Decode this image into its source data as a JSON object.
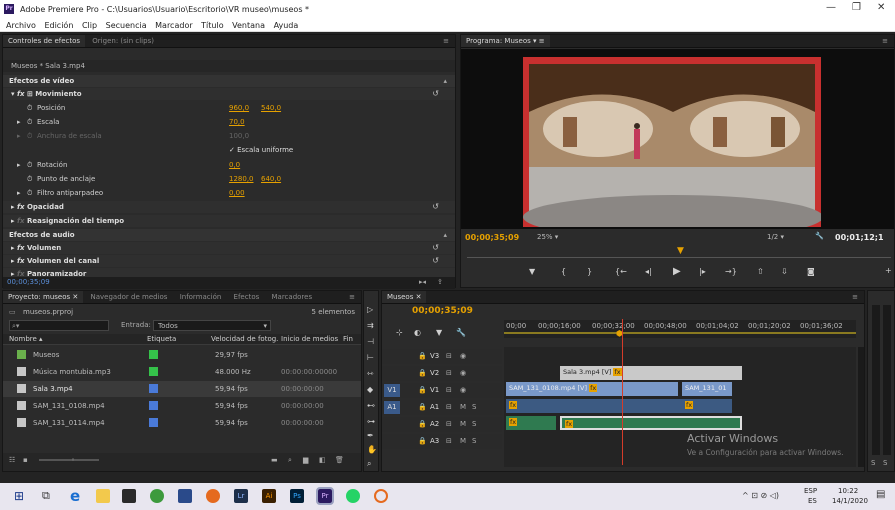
{
  "window": {
    "title": "Adobe Premiere Pro - C:\\Usuarios\\Usuario\\Escritorio\\VR museo\\museos *",
    "app_icon": "Pr"
  },
  "menu": [
    "Archivo",
    "Edición",
    "Clip",
    "Secuencia",
    "Marcador",
    "Título",
    "Ventana",
    "Ayuda"
  ],
  "effects_panel": {
    "tabs": [
      "Controles de efectos",
      "Origen: (sin clips)"
    ],
    "clip": "Museos * Sala 3.mp4",
    "video_header": "Efectos de vídeo",
    "movement": "Movimiento",
    "position_label": "Posición",
    "position_x": "960,0",
    "position_y": "540,0",
    "scale_label": "Escala",
    "scale_value": "70,0",
    "scale_width_label": "Anchura de escala",
    "scale_width_value": "100,0",
    "uniform_scale": "Escala uniforme",
    "rotation_label": "Rotación",
    "rotation_value": "0,0",
    "anchor_label": "Punto de anclaje",
    "anchor_x": "1280,0",
    "anchor_y": "640,0",
    "flicker_label": "Filtro antiparpadeo",
    "flicker_value": "0,00",
    "opacity": "Opacidad",
    "time_remap": "Reasignación del tiempo",
    "audio_header": "Efectos de audio",
    "volume": "Volumen",
    "channel_volume": "Volumen del canal",
    "panner": "Panoramizador",
    "timecode": "00;00;35;09"
  },
  "program_monitor": {
    "tab": "Programa: Museos",
    "timecode": "00;00;35;09",
    "zoom": "25%",
    "resolution": "1/2",
    "duration": "00;01;12;1",
    "frame_border_color": "#c8302f"
  },
  "project_panel": {
    "tabs": [
      "Proyecto: museos",
      "Navegador de medios",
      "Información",
      "Efectos",
      "Marcadores"
    ],
    "file": "museos.prproj",
    "count": "5 elementos",
    "search_placeholder": "",
    "entries_label": "Entrada:",
    "entries_value": "Todos",
    "columns": [
      "Nombre",
      "Etiqueta",
      "Velocidad de fotog.",
      "Inicio de medios",
      "Fin"
    ],
    "items": [
      {
        "name": "Museos",
        "color": "#35c24a",
        "fps": "29,97 fps",
        "start": ""
      },
      {
        "name": "Música montubia.mp3",
        "color": "#35c24a",
        "fps": "48.000 Hz",
        "start": "00:00:00:00000"
      },
      {
        "name": "Sala 3.mp4",
        "color": "#4a7ad8",
        "fps": "59,94 fps",
        "start": "00:00:00:00"
      },
      {
        "name": "SAM_131_0108.mp4",
        "color": "#4a7ad8",
        "fps": "59,94 fps",
        "start": "00:00:00:00"
      },
      {
        "name": "SAM_131_0114.mp4",
        "color": "#4a7ad8",
        "fps": "59,94 fps",
        "start": "00:00:00:00"
      }
    ]
  },
  "timeline": {
    "tab": "Museos",
    "timecode": "00;00;35;09",
    "ruler": [
      "00;00",
      "00;00;16;00",
      "00;00;32;00",
      "00;00;48;00",
      "00;01;04;02",
      "00;01;20;02",
      "00;01;36;02"
    ],
    "tracks": [
      {
        "name": "V3",
        "src": ""
      },
      {
        "name": "V2",
        "src": ""
      },
      {
        "name": "V1",
        "src": "V1"
      },
      {
        "name": "A1",
        "src": "A1"
      },
      {
        "name": "A2",
        "src": ""
      },
      {
        "name": "A3",
        "src": ""
      }
    ],
    "clips": {
      "v2": "Sala 3.mp4 [V]",
      "v1a": "SAM_131_0108.mp4 [V]",
      "v1b": "SAM_131_01"
    },
    "fx_badge": "fx"
  },
  "watermark": {
    "line1": "Activar Windows",
    "line2": "Ve a Configuración para activar Windows."
  },
  "taskbar": {
    "lang": "ESP",
    "lang2": "ES",
    "time": "10:22",
    "date": "14/1/2020",
    "app_labels": [
      "Lr",
      "Ai",
      "Ps",
      "Pr"
    ]
  }
}
